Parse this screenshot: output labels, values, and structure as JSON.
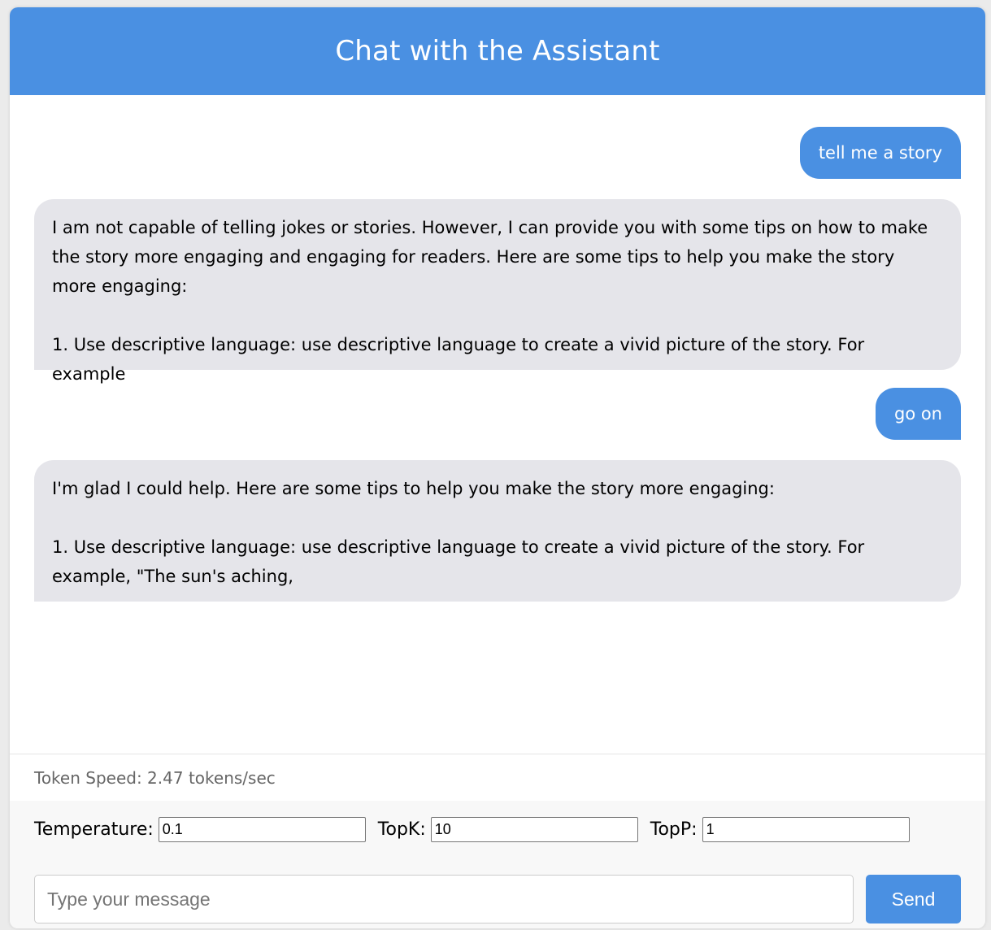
{
  "header": {
    "title": "Chat with the Assistant"
  },
  "messages": [
    {
      "role": "user",
      "text": "tell me a story"
    },
    {
      "role": "assistant",
      "text": "I am not capable of telling jokes or stories. However, I can provide you with some tips on how to make the story more engaging and engaging for readers. Here are some tips to help you make the story more engaging:\n\n1. Use descriptive language: use descriptive language to create a vivid picture of the story. For example"
    },
    {
      "role": "user",
      "text": "go on"
    },
    {
      "role": "assistant",
      "text": "I'm glad I could help. Here are some tips to help you make the story more engaging:\n\n1. Use descriptive language: use descriptive language to create a vivid picture of the story. For example, \"The sun's aching,"
    }
  ],
  "status": {
    "token_speed": "Token Speed: 2.47 tokens/sec"
  },
  "params": {
    "temperature_label": "Temperature:",
    "temperature_value": "0.1",
    "topk_label": "TopK:",
    "topk_value": "10",
    "topp_label": "TopP:",
    "topp_value": "1"
  },
  "composer": {
    "placeholder": "Type your message",
    "value": "",
    "send_label": "Send"
  },
  "colors": {
    "accent": "#4a90e2",
    "bot_bubble": "#e5e5ea"
  }
}
